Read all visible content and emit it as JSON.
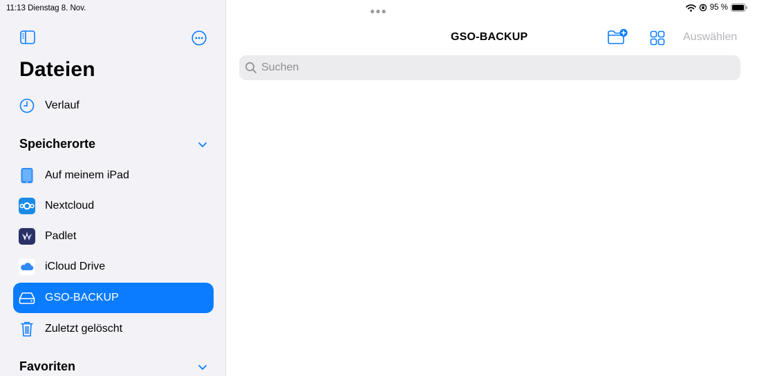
{
  "status_bar": {
    "time_date": "11:13  Dienstag 8. Nov.",
    "battery": "95 %"
  },
  "sidebar": {
    "title": "Dateien",
    "recent": {
      "label": "Verlauf"
    },
    "sections": [
      {
        "title": "Speicherorte",
        "items": [
          {
            "label": "Auf meinem iPad",
            "icon": "ipad-icon"
          },
          {
            "label": "Nextcloud",
            "icon": "nextcloud-icon"
          },
          {
            "label": "Padlet",
            "icon": "padlet-icon"
          },
          {
            "label": "iCloud Drive",
            "icon": "icloud-icon"
          },
          {
            "label": "GSO-BACKUP",
            "icon": "external-drive-icon",
            "selected": true
          },
          {
            "label": "Zuletzt gelöscht",
            "icon": "trash-icon"
          }
        ]
      },
      {
        "title": "Favoriten",
        "items": []
      }
    ]
  },
  "main": {
    "title": "GSO-BACKUP",
    "select_label": "Auswählen",
    "search": {
      "placeholder": "Suchen",
      "value": ""
    }
  },
  "colors": {
    "accent": "#0a7cff",
    "sidebar_bg": "#f2f2f7",
    "disabled_text": "#b4b4b9"
  }
}
